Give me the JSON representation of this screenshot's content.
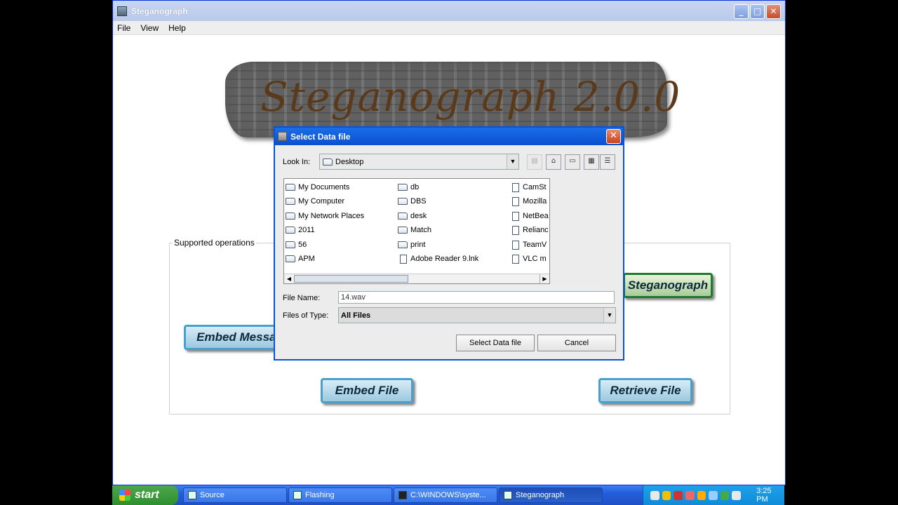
{
  "main_window": {
    "title": "Steganograph",
    "menu": [
      "File",
      "View",
      "Help"
    ],
    "logo_text": "Steganograph 2.0.0",
    "group_title": "Supported operations",
    "buttons": {
      "embed_message": "Embed Messag",
      "steganograph": "Steganograph",
      "embed_file": "Embed File",
      "retrieve_file": "Retrieve File"
    }
  },
  "dialog": {
    "title": "Select Data file",
    "look_in_label": "Look In:",
    "look_in_value": "Desktop",
    "files": {
      "col1": [
        "My Documents",
        "My Computer",
        "My Network Places",
        "2011",
        "56",
        "APM"
      ],
      "col2": [
        "db",
        "DBS",
        "desk",
        "Match",
        "print",
        "Adobe Reader 9.lnk"
      ],
      "col3": [
        "CamSt",
        "Mozilla",
        "NetBea",
        "Relianc",
        "TeamV",
        "VLC m"
      ]
    },
    "file_name_label": "File Name:",
    "file_name_value": "14.wav",
    "files_of_type_label": "Files of Type:",
    "files_of_type_value": "All Files",
    "select_button": "Select Data file",
    "cancel_button": "Cancel"
  },
  "taskbar": {
    "start_label": "start",
    "tasks": [
      "Source",
      "Flashing",
      "C:\\WINDOWS\\syste...",
      "Steganograph"
    ],
    "clock": "3:25 PM"
  }
}
